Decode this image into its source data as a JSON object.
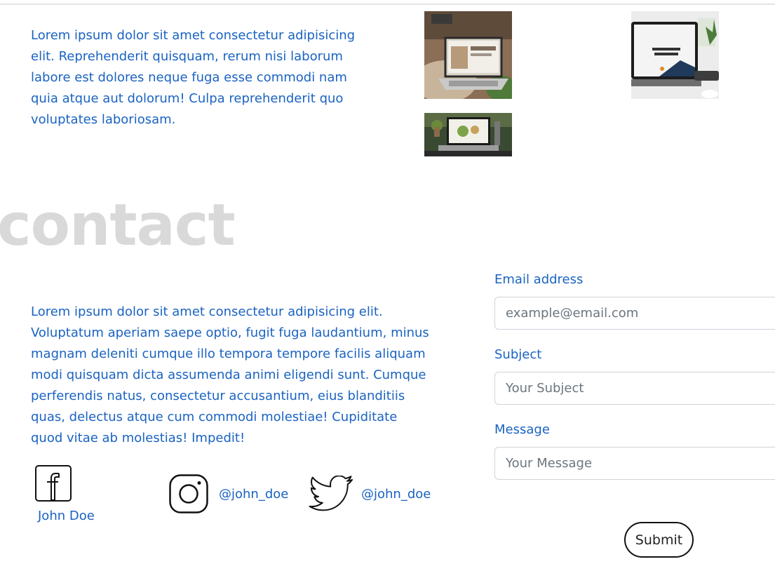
{
  "about": {
    "text": "Lorem ipsum dolor sit amet consectetur adipisicing elit. Reprehenderit quisquam, rerum nisi laborum labore est dolores neque fuga esse commodi nam quia atque aut dolorum! Culpa reprehenderit quo voluptates laboriosam."
  },
  "gallery": {
    "images": [
      "laptop-photo-website",
      "laptop-photo-workhard-anywhere",
      "laptop-photo-food-website"
    ]
  },
  "contact": {
    "title": "contact",
    "text": "Lorem ipsum dolor sit amet consectetur adipisicing elit. Voluptatum aperiam saepe optio, fugit fuga laudantium, minus magnam deleniti cumque illo tempora tempore facilis aliquam modi quisquam dicta assumenda animi eligendi sunt. Cumque perferendis natus, consectetur accusantium, eius blanditiis quas, delectus atque cum commodi molestiae! Cupiditate quod vitae ab molestias! Impedit!",
    "social": {
      "facebook": {
        "icon": "facebook-icon",
        "name": "John Doe"
      },
      "instagram": {
        "icon": "instagram-icon",
        "handle": "@john_doe"
      },
      "twitter": {
        "icon": "twitter-icon",
        "handle": "@john_doe"
      }
    },
    "form": {
      "email_label": "Email address",
      "email_placeholder": "example@email.com",
      "subject_label": "Subject",
      "subject_placeholder": "Your Subject",
      "message_label": "Message",
      "message_placeholder": "Your Message",
      "submit_label": "Submit"
    }
  },
  "colors": {
    "text_blue": "#1a63c2",
    "title_gray": "#d9d9d9",
    "input_border": "#ced4da"
  }
}
